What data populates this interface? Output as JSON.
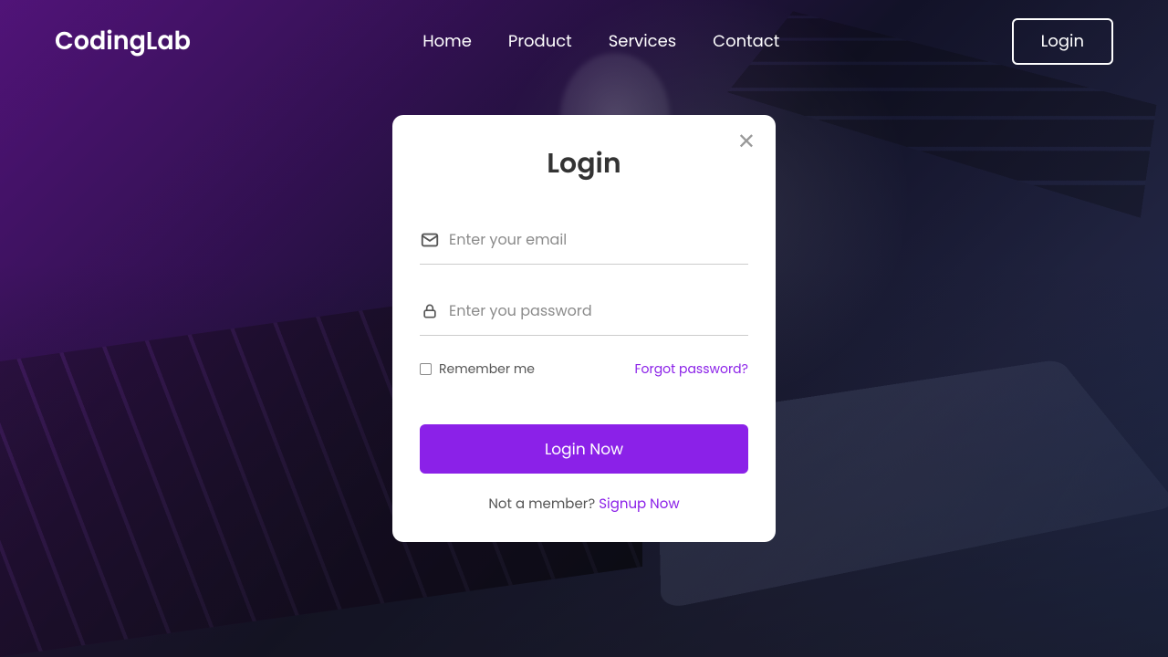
{
  "header": {
    "logo": "CodingLab",
    "nav": [
      "Home",
      "Product",
      "Services",
      "Contact"
    ],
    "login_button": "Login"
  },
  "form": {
    "title": "Login",
    "email_placeholder": "Enter your email",
    "password_placeholder": "Enter you password",
    "remember_label": "Remember me",
    "forgot_label": "Forgot password?",
    "submit_label": "Login Now",
    "signup_prompt": "Not a member? ",
    "signup_link": "Signup Now"
  },
  "colors": {
    "accent": "#8b21e8"
  }
}
